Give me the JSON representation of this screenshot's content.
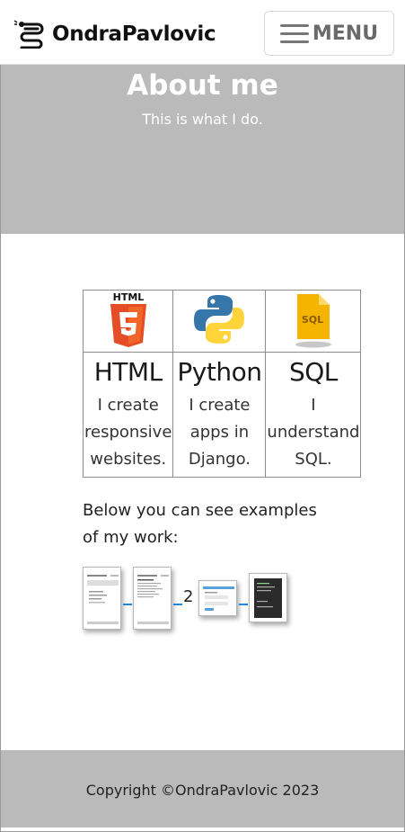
{
  "navbar": {
    "brand_name": "OndraPavlovic",
    "menu_label": "MENU"
  },
  "hero": {
    "title": "About me",
    "subtitle": "This is what I do."
  },
  "skills": [
    {
      "icon": "html5-icon",
      "title": "HTML",
      "description_lines": [
        "I create",
        "responsive",
        "websites."
      ]
    },
    {
      "icon": "python-icon",
      "title": "Python",
      "description_lines": [
        "I create",
        "apps in",
        "Django."
      ]
    },
    {
      "icon": "sql-file-icon",
      "title": "SQL",
      "description_lines": [
        "I",
        "understand",
        "SQL."
      ]
    }
  ],
  "examples": {
    "intro": "Below you can see examples of my work:",
    "count": "2"
  },
  "footer": {
    "copyright": "Copyright ©OndraPavlovic 2023"
  },
  "colors": {
    "hero_bg": "#bababa",
    "footer_bg": "#bababa",
    "html_orange": "#e44d26",
    "python_blue": "#3776ab",
    "python_yellow": "#ffd43b",
    "sql_yellow": "#f5b400"
  }
}
